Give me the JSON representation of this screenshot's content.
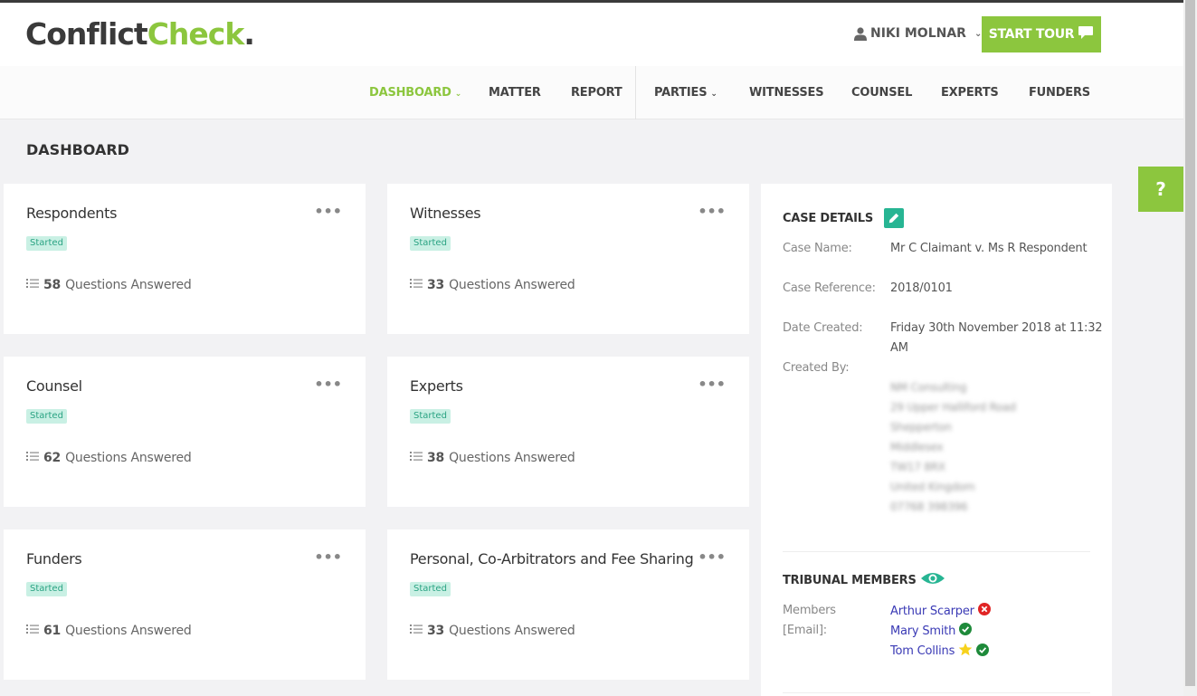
{
  "logo": {
    "part1": "Conflict",
    "part2": "Check",
    "part3": "."
  },
  "user": {
    "name": "NIKI MOLNAR"
  },
  "tour_button": {
    "label": "START TOUR"
  },
  "nav": {
    "items": [
      {
        "label": "DASHBOARD",
        "active": true,
        "dropdown": true
      },
      {
        "label": "MATTER"
      },
      {
        "label": "REPORT"
      },
      {
        "label": "PARTIES",
        "dropdown": true
      },
      {
        "label": "WITNESSES"
      },
      {
        "label": "COUNSEL"
      },
      {
        "label": "EXPERTS"
      },
      {
        "label": "FUNDERS"
      }
    ]
  },
  "page_title": "DASHBOARD",
  "cards": [
    {
      "title": "Respondents",
      "status": "Started",
      "count": "58",
      "count_label": "Questions Answered"
    },
    {
      "title": "Witnesses",
      "status": "Started",
      "count": "33",
      "count_label": "Questions Answered"
    },
    {
      "title": "Counsel",
      "status": "Started",
      "count": "62",
      "count_label": "Questions Answered"
    },
    {
      "title": "Experts",
      "status": "Started",
      "count": "38",
      "count_label": "Questions Answered"
    },
    {
      "title": "Funders",
      "status": "Started",
      "count": "61",
      "count_label": "Questions Answered"
    },
    {
      "title": "Personal, Co-Arbitrators and Fee Sharing",
      "status": "Started",
      "count": "33",
      "count_label": "Questions Answered"
    }
  ],
  "case_details": {
    "title": "CASE DETAILS",
    "case_name_label": "Case Name:",
    "case_name": "Mr C Claimant v. Ms R Respondent",
    "case_ref_label": "Case Reference:",
    "case_ref": "2018/0101",
    "date_created_label": "Date Created:",
    "date_created_line1": "Friday 30th November 2018 at 11:32",
    "date_created_line2": "AM",
    "created_by_label": "Created By:",
    "created_by_lines": [
      "NM Consulting",
      "29 Upper Halliford Road",
      "Shepperton",
      "Middlesex",
      "TW17 8RX",
      "United Kingdom",
      "07768 398396"
    ]
  },
  "tribunal": {
    "title": "TRIBUNAL MEMBERS",
    "members_label_1": "Members",
    "members_label_2": "[Email]:",
    "members": [
      {
        "name": "Arthur Scarper",
        "status": "declined"
      },
      {
        "name": "Mary Smith",
        "status": "accepted"
      },
      {
        "name": "Tom Collins",
        "status": "accepted",
        "starred": true
      }
    ]
  },
  "help": {
    "label": "?"
  },
  "colors": {
    "brand_green": "#8cc63e",
    "teal": "#27b593",
    "badge_bg": "#c9f0e4",
    "link": "#3a3ab5"
  }
}
